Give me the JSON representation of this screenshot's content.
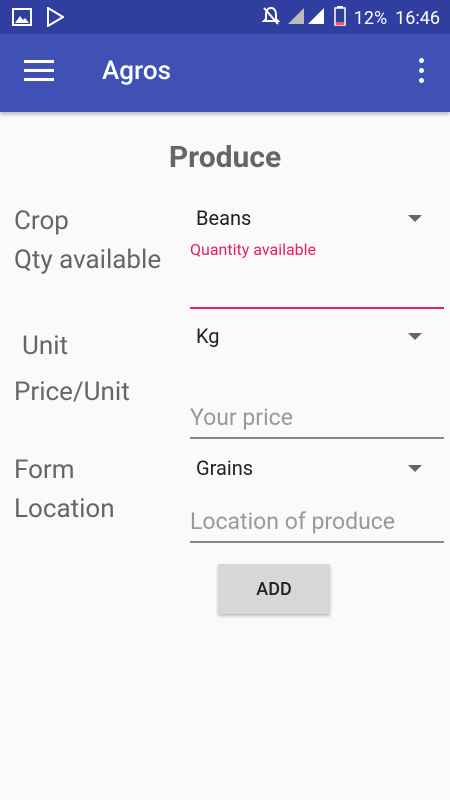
{
  "status_bar": {
    "battery": "12%",
    "time": "16:46"
  },
  "app_bar": {
    "title": "Agros"
  },
  "form": {
    "heading": "Produce",
    "crop_label": "Crop",
    "crop_value": "Beans",
    "qty_label": "Qty available",
    "qty_hint": "Quantity available",
    "unit_label": "Unit",
    "unit_value": "Kg",
    "price_label": "Price/Unit",
    "price_placeholder": "Your price",
    "form_label": "Form",
    "form_value": "Grains",
    "location_label": "Location",
    "location_placeholder": "Location of produce",
    "add_label": "ADD"
  },
  "colors": {
    "primary": "#3F51B5",
    "primary_dark": "#303F9F",
    "accent": "#E91E63"
  },
  "icons": [
    "image-icon",
    "play-store-icon",
    "notifications-off-icon",
    "signal-icon",
    "battery-icon",
    "menu-icon",
    "more-vert-icon",
    "dropdown-arrow-icon"
  ]
}
